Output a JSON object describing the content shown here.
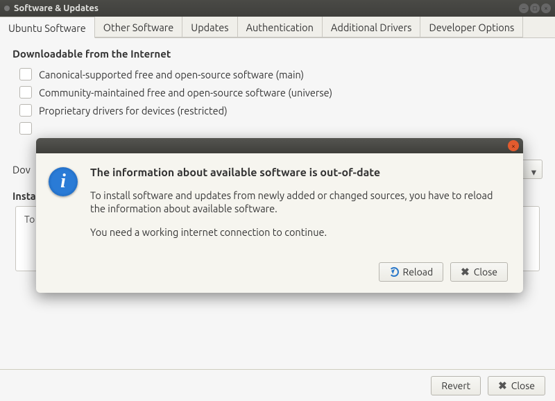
{
  "window": {
    "title": "Software & Updates"
  },
  "tabs": [
    {
      "label": "Ubuntu Software",
      "active": true
    },
    {
      "label": "Other Software"
    },
    {
      "label": "Updates"
    },
    {
      "label": "Authentication"
    },
    {
      "label": "Additional Drivers"
    },
    {
      "label": "Developer Options"
    }
  ],
  "section_internet": {
    "title": "Downloadable from the Internet"
  },
  "repos": [
    {
      "label": "Canonical-supported free and open-source software (main)",
      "checked": false
    },
    {
      "label": "Community-maintained free and open-source software (universe)",
      "checked": false
    },
    {
      "label": "Proprietary drivers for devices (restricted)",
      "checked": false
    },
    {
      "label": "",
      "checked": false
    },
    {
      "label": "",
      "checked": false
    }
  ],
  "download": {
    "label_prefix": "Dov"
  },
  "installable": {
    "label_prefix": "Insta",
    "box_prefix": "To "
  },
  "dialog": {
    "title": "The information about available software is out-of-date",
    "para1": "To install software and updates from newly added or changed sources, you have to reload the information about available software.",
    "para2": "You need a working internet connection to continue.",
    "reload_label": "Reload",
    "close_label": "Close"
  },
  "footer": {
    "revert_label": "Revert",
    "close_label": "Close"
  }
}
